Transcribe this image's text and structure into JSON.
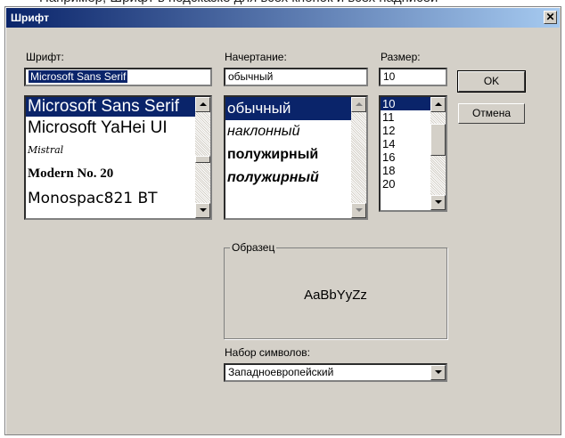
{
  "dialog": {
    "title": "Шрифт",
    "close_glyph": "✕"
  },
  "font": {
    "label": "Шрифт:",
    "value": "Microsoft Sans Serif",
    "items": [
      "Microsoft Sans Serif",
      "Microsoft YaHei UI",
      "Mistral",
      "Modern No. 20",
      "Monospac821  BT"
    ]
  },
  "style": {
    "label": "Начертание:",
    "value": "обычный",
    "items": [
      "обычный",
      "наклонный",
      "полужирный",
      "полужирный"
    ]
  },
  "size": {
    "label": "Размер:",
    "value": "10",
    "items": [
      "10",
      "11",
      "12",
      "14",
      "16",
      "18",
      "20"
    ]
  },
  "buttons": {
    "ok": "OK",
    "cancel": "Отмена"
  },
  "sample": {
    "group_label": "Образец",
    "text": "AaBbYyZz"
  },
  "charset": {
    "label": "Набор символов:",
    "value": "Западноевропейский"
  },
  "colors": {
    "title_start": "#0a246a",
    "title_end": "#a6caf0",
    "selection": "#0a246a",
    "face": "#d4d0c8"
  },
  "icons": [
    "close-icon",
    "scroll-up-arrow-icon",
    "scroll-down-arrow-icon",
    "dropdown-arrow-icon"
  ]
}
